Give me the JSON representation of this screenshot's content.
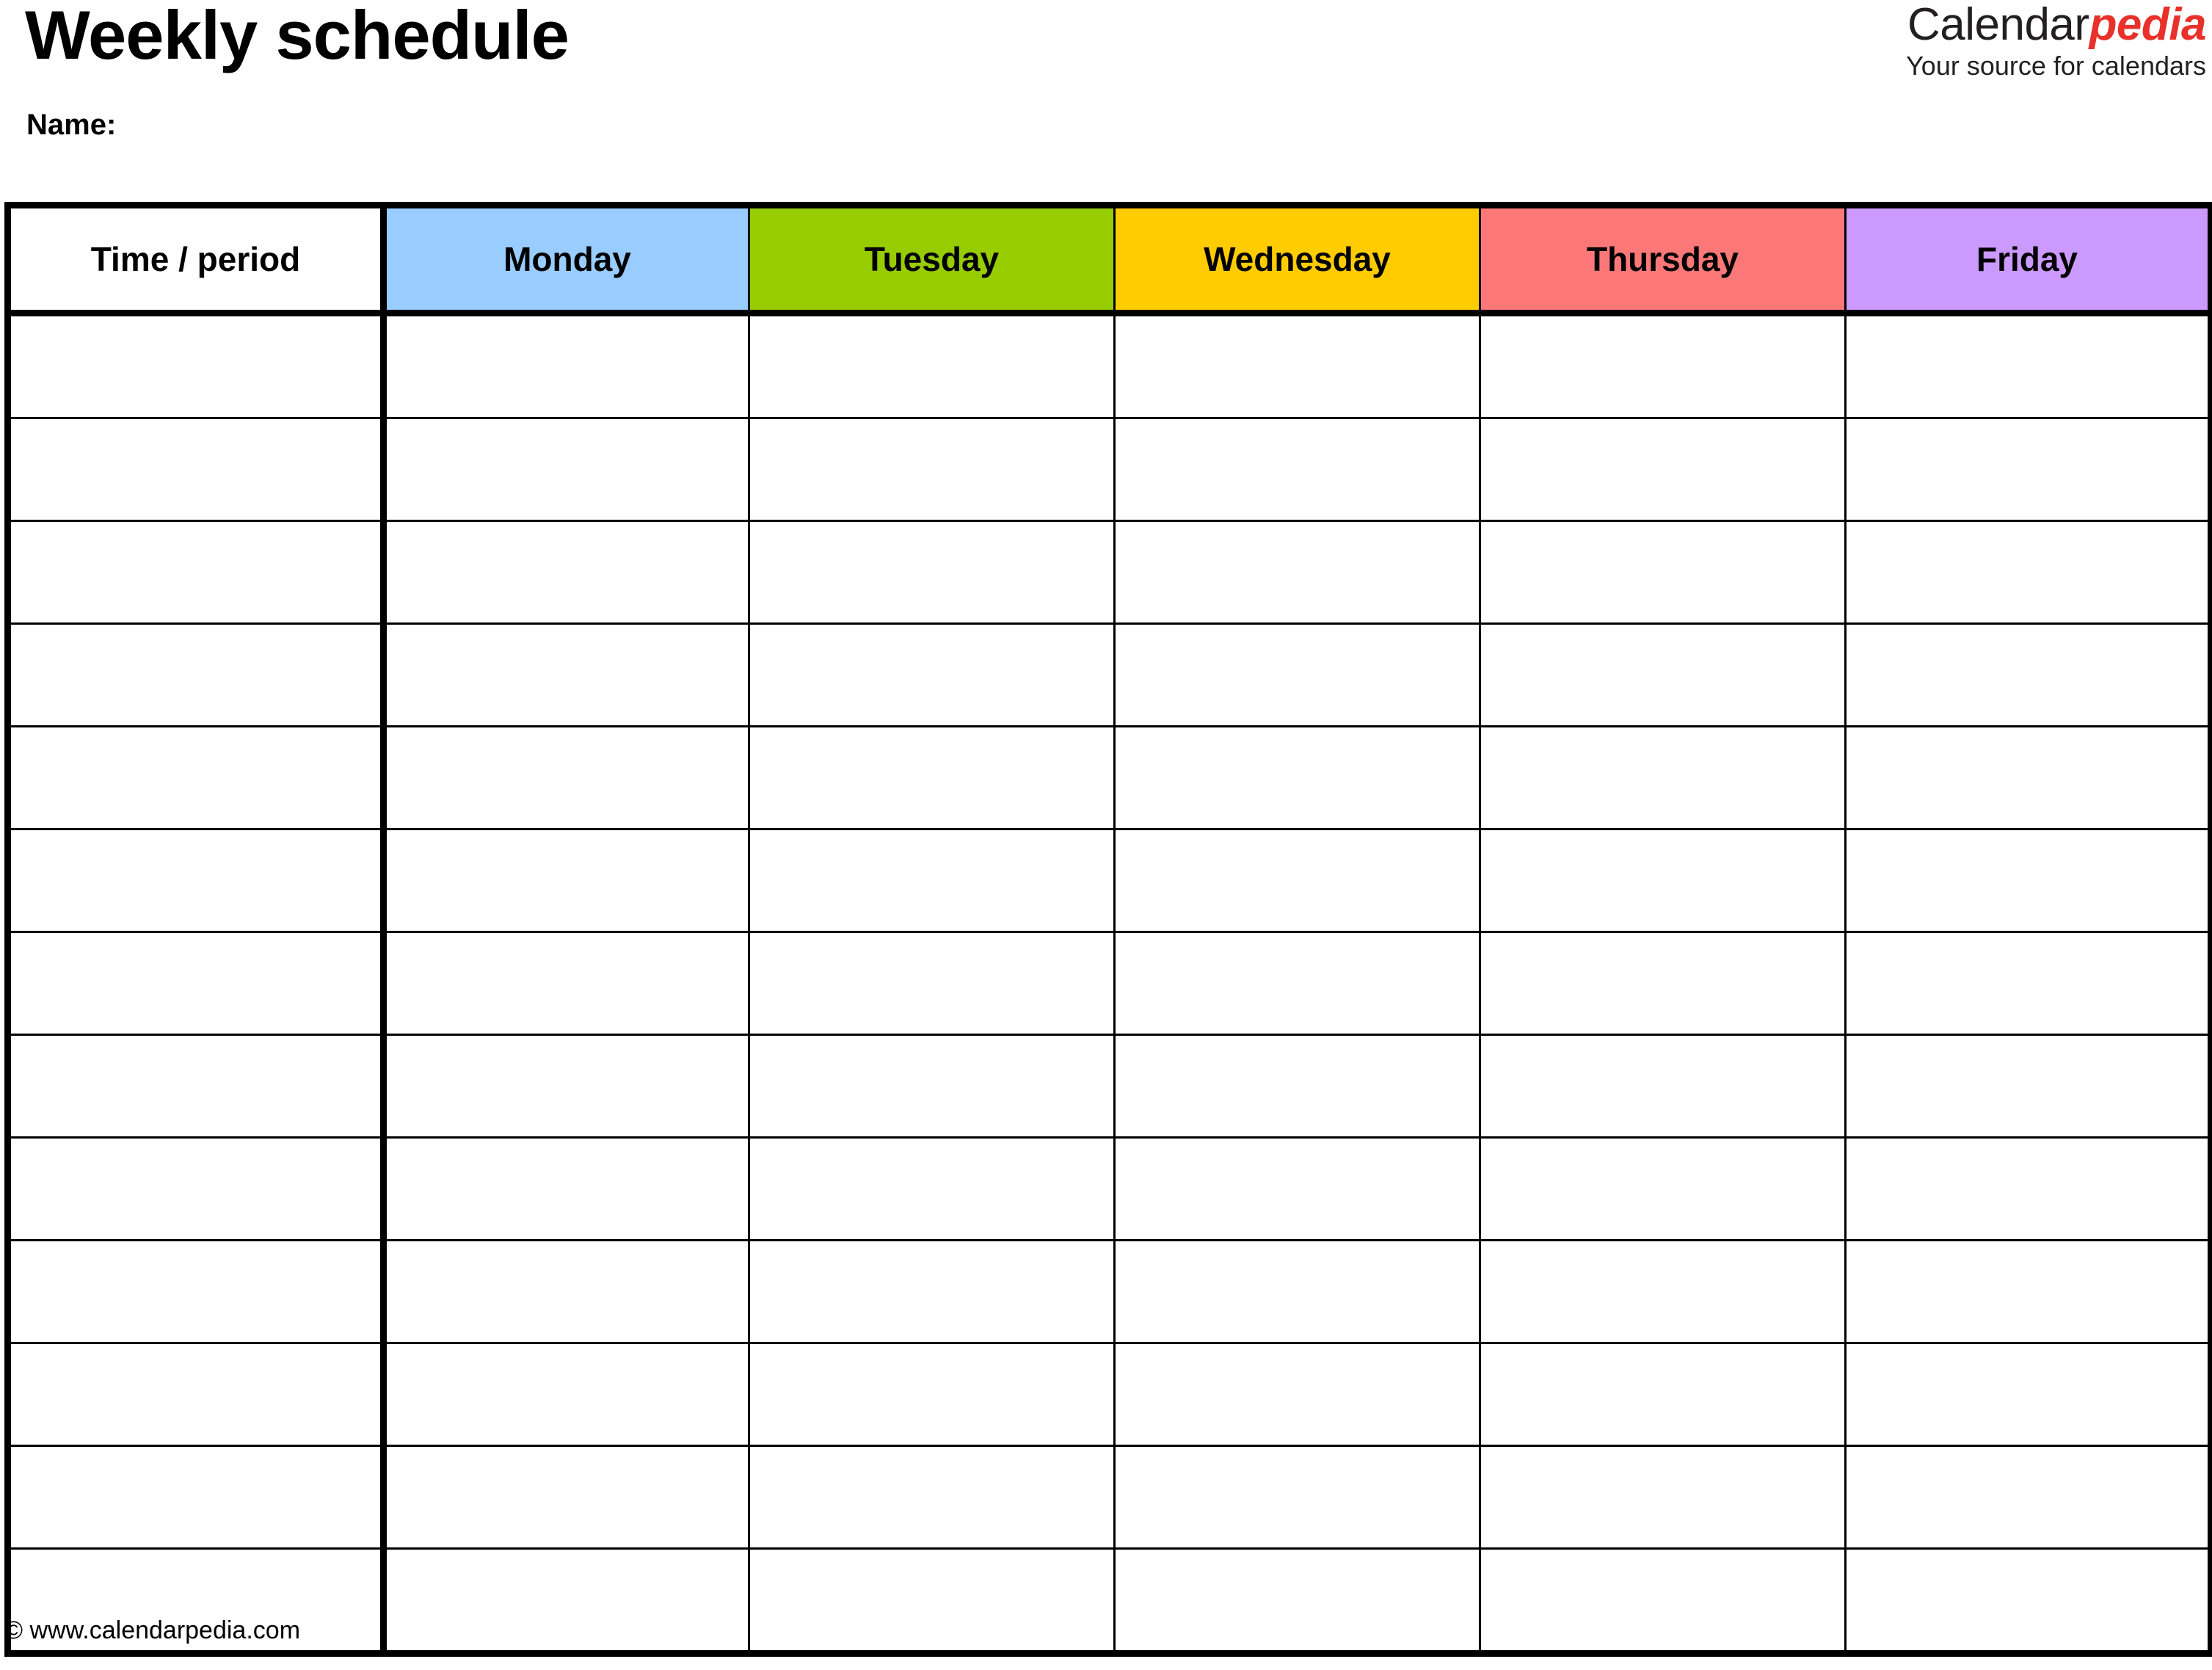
{
  "document": {
    "title": "Weekly schedule",
    "name_label": "Name:"
  },
  "brand": {
    "word_primary": "Calendar",
    "word_accent": "pedia",
    "tagline": "Your source for calendars",
    "accent_color": "#e8312a",
    "primary_color": "#231f20"
  },
  "table": {
    "columns": [
      {
        "key": "time",
        "label": "Time / period",
        "background": "#ffffff"
      },
      {
        "key": "monday",
        "label": "Monday",
        "background": "#99ccff"
      },
      {
        "key": "tuesday",
        "label": "Tuesday",
        "background": "#96cc00"
      },
      {
        "key": "wednesday",
        "label": "Wednesday",
        "background": "#ffcc00"
      },
      {
        "key": "thursday",
        "label": "Thursday",
        "background": "#fc7878"
      },
      {
        "key": "friday",
        "label": "Friday",
        "background": "#cc99ff"
      }
    ],
    "row_count": 13,
    "rows": [
      {
        "time": "",
        "monday": "",
        "tuesday": "",
        "wednesday": "",
        "thursday": "",
        "friday": ""
      },
      {
        "time": "",
        "monday": "",
        "tuesday": "",
        "wednesday": "",
        "thursday": "",
        "friday": ""
      },
      {
        "time": "",
        "monday": "",
        "tuesday": "",
        "wednesday": "",
        "thursday": "",
        "friday": ""
      },
      {
        "time": "",
        "monday": "",
        "tuesday": "",
        "wednesday": "",
        "thursday": "",
        "friday": ""
      },
      {
        "time": "",
        "monday": "",
        "tuesday": "",
        "wednesday": "",
        "thursday": "",
        "friday": ""
      },
      {
        "time": "",
        "monday": "",
        "tuesday": "",
        "wednesday": "",
        "thursday": "",
        "friday": ""
      },
      {
        "time": "",
        "monday": "",
        "tuesday": "",
        "wednesday": "",
        "thursday": "",
        "friday": ""
      },
      {
        "time": "",
        "monday": "",
        "tuesday": "",
        "wednesday": "",
        "thursday": "",
        "friday": ""
      },
      {
        "time": "",
        "monday": "",
        "tuesday": "",
        "wednesday": "",
        "thursday": "",
        "friday": ""
      },
      {
        "time": "",
        "monday": "",
        "tuesday": "",
        "wednesday": "",
        "thursday": "",
        "friday": ""
      },
      {
        "time": "",
        "monday": "",
        "tuesday": "",
        "wednesday": "",
        "thursday": "",
        "friday": ""
      },
      {
        "time": "",
        "monday": "",
        "tuesday": "",
        "wednesday": "",
        "thursday": "",
        "friday": ""
      },
      {
        "time": "",
        "monday": "",
        "tuesday": "",
        "wednesday": "",
        "thursday": "",
        "friday": ""
      }
    ]
  },
  "footer": {
    "copyright": "© www.calendarpedia.com"
  }
}
